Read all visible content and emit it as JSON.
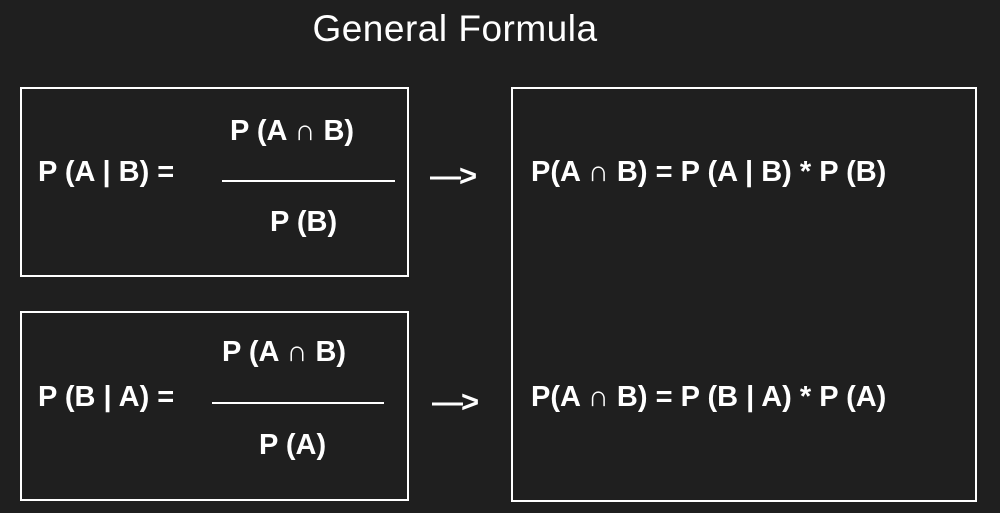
{
  "title": "General Formula",
  "formula_top": {
    "lhs": "P (A | B) =",
    "numerator": "P (A ∩ B)",
    "denominator": "P (B)"
  },
  "formula_bottom": {
    "lhs": "P (B | A) =",
    "numerator": "P (A ∩ B)",
    "denominator": "P (A)"
  },
  "arrow_top": "—>",
  "arrow_bottom": "—>",
  "result_top": "P(A ∩ B) = P (A | B) * P (B)",
  "result_bottom": "P(A ∩ B) = P (B | A) * P (A)",
  "colors": {
    "background": "#1f1f1f",
    "foreground": "#ffffff"
  }
}
